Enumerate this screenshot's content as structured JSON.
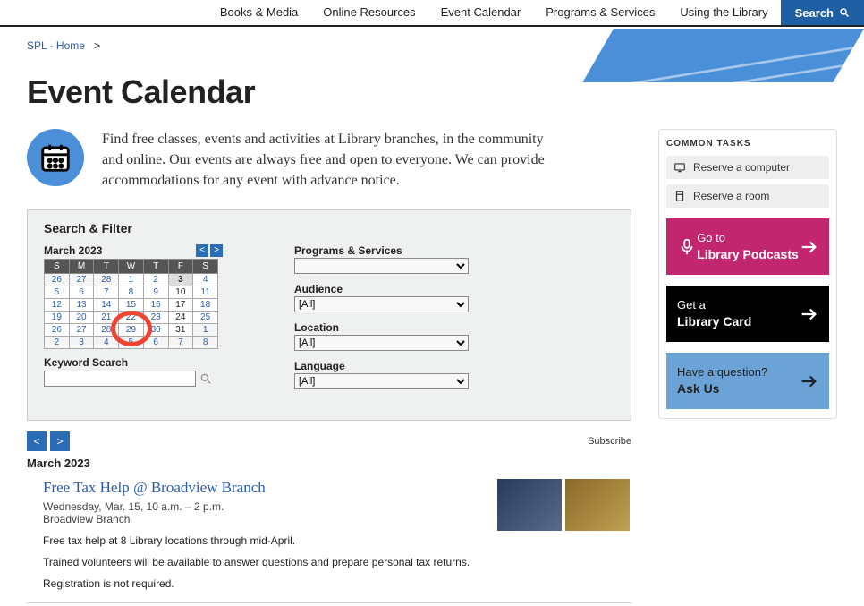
{
  "nav": {
    "items": [
      "Books & Media",
      "Online Resources",
      "Event Calendar",
      "Programs & Services",
      "Using the Library"
    ],
    "search": "Search"
  },
  "breadcrumb": {
    "home": "SPL - Home",
    "sep": ">"
  },
  "page_title": "Event Calendar",
  "intro": "Find free classes, events and activities at Library branches, in the community and online. Our events are always free and open to everyone. We can provide accommodations for any event with advance notice.",
  "sidebar": {
    "common_tasks_title": "COMMON TASKS",
    "tasks": [
      {
        "label": "Reserve a computer"
      },
      {
        "label": "Reserve a room"
      }
    ],
    "ctas": [
      {
        "line1": "Go to",
        "line2": "Library Podcasts",
        "style": "pink",
        "icon": "podcast"
      },
      {
        "line1": "Get a",
        "line2": "Library Card",
        "style": "black",
        "icon": "arrow"
      },
      {
        "line1": "Have a question?",
        "line2": "Ask Us",
        "style": "blue",
        "icon": "arrow"
      }
    ]
  },
  "filter": {
    "title": "Search & Filter",
    "month": "March 2023",
    "dow": [
      "S",
      "M",
      "T",
      "W",
      "T",
      "F",
      "S"
    ],
    "weeks": [
      [
        {
          "d": 26,
          "cls": "other"
        },
        {
          "d": 27,
          "cls": "other"
        },
        {
          "d": 28,
          "cls": "other"
        },
        {
          "d": 1
        },
        {
          "d": 2
        },
        {
          "d": 3,
          "cls": "today"
        },
        {
          "d": 4
        }
      ],
      [
        {
          "d": 5
        },
        {
          "d": 6
        },
        {
          "d": 7
        },
        {
          "d": 8
        },
        {
          "d": 9
        },
        {
          "d": 10,
          "cls": "black"
        },
        {
          "d": 11
        }
      ],
      [
        {
          "d": 12
        },
        {
          "d": 13
        },
        {
          "d": 14
        },
        {
          "d": 15
        },
        {
          "d": 16
        },
        {
          "d": 17,
          "cls": "black"
        },
        {
          "d": 18
        }
      ],
      [
        {
          "d": 19
        },
        {
          "d": 20
        },
        {
          "d": 21
        },
        {
          "d": 22
        },
        {
          "d": 23
        },
        {
          "d": 24,
          "cls": "black"
        },
        {
          "d": 25
        }
      ],
      [
        {
          "d": 26
        },
        {
          "d": 27
        },
        {
          "d": 28
        },
        {
          "d": 29
        },
        {
          "d": 30
        },
        {
          "d": 31,
          "cls": "black"
        },
        {
          "d": 1,
          "cls": "other"
        }
      ],
      [
        {
          "d": 2,
          "cls": "other"
        },
        {
          "d": 3,
          "cls": "other"
        },
        {
          "d": 4,
          "cls": "other"
        },
        {
          "d": 5,
          "cls": "other"
        },
        {
          "d": 6,
          "cls": "other"
        },
        {
          "d": 7,
          "cls": "other"
        },
        {
          "d": 8,
          "cls": "other"
        }
      ]
    ],
    "kw_label": "Keyword Search",
    "selects": [
      {
        "label": "Programs & Services",
        "value": ""
      },
      {
        "label": "Audience",
        "value": "[All]"
      },
      {
        "label": "Location",
        "value": "[All]"
      },
      {
        "label": "Language",
        "value": "[All]"
      }
    ]
  },
  "subscribe": "Subscribe",
  "results": {
    "month": "March 2023",
    "event": {
      "title": "Free Tax Help @ Broadview Branch",
      "meta": "Wednesday, Mar. 15, 10 a.m. – 2 p.m.",
      "loc": "Broadview Branch",
      "desc1": "Free tax help at 8 Library locations through mid-April.",
      "desc2": "Trained volunteers will be available to answer questions and prepare personal tax returns.",
      "desc3": "Registration is not required."
    }
  }
}
